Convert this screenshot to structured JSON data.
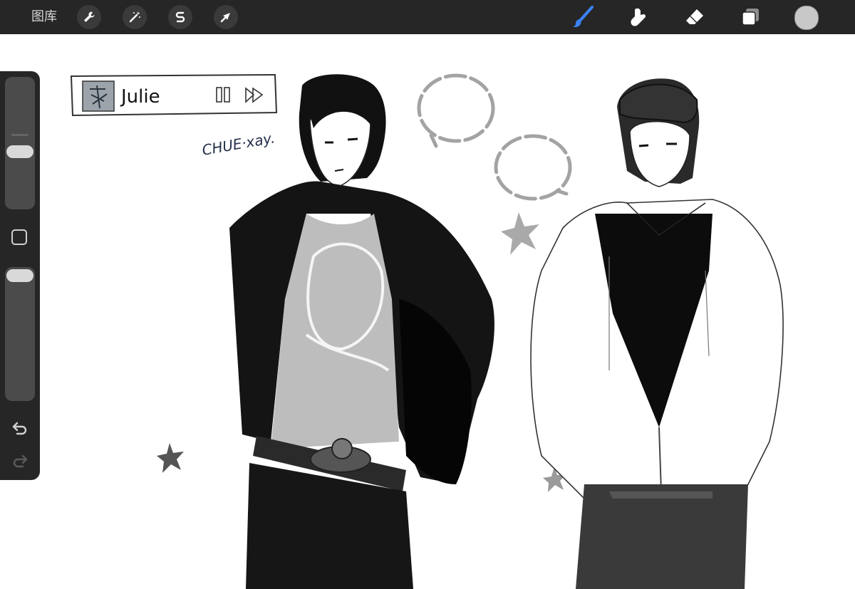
{
  "topbar": {
    "gallery_label": "图库",
    "left_tools": [
      {
        "icon": "wrench-icon"
      },
      {
        "icon": "magic-wand-icon"
      },
      {
        "icon": "selection-s-icon"
      },
      {
        "icon": "transform-arrow-icon"
      }
    ],
    "right_tools": [
      {
        "icon": "brush-icon",
        "active": true
      },
      {
        "icon": "smudge-icon"
      },
      {
        "icon": "eraser-icon"
      },
      {
        "icon": "layers-icon"
      }
    ],
    "current_color": "#c8c8c8",
    "accent": "#3b82f6"
  },
  "sidebar": {
    "brush_size_level": 0.55,
    "opacity_level": 0.95,
    "modify_button_icon": "square-icon",
    "undo_icon": "undo-icon",
    "redo_icon": "redo-icon"
  },
  "canvas": {
    "music_widget": {
      "title": "Julie",
      "pause_icon": "pause-icon",
      "forward_icon": "forward-icon"
    },
    "signature": "CHUE·xay."
  }
}
